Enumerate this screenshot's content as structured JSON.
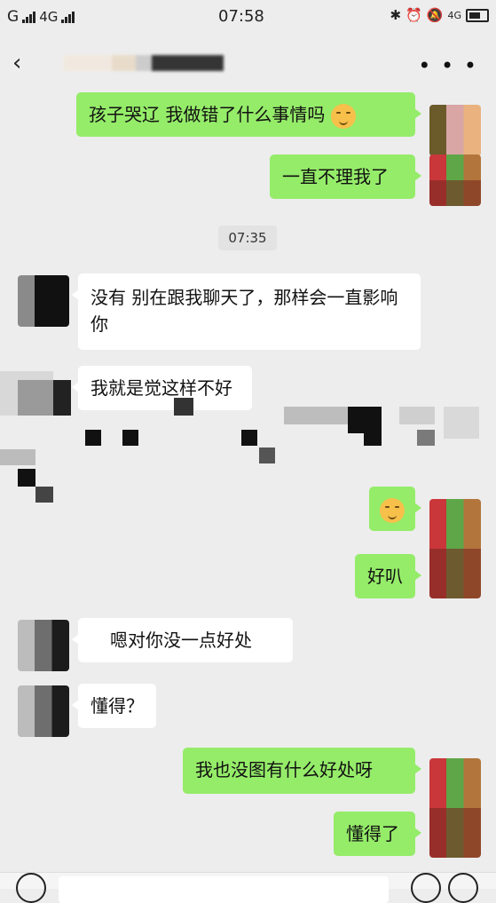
{
  "status_bar": {
    "carrier_g": "G",
    "network": "4G",
    "time": "07:58",
    "right_network": "4G"
  },
  "header": {
    "title": "",
    "back_icon": "chevron-left-icon",
    "more_icon": "more-dots-icon"
  },
  "messages": [
    {
      "side": "me",
      "text": "孩子哭辽 我做错了什么事情吗",
      "emoji": "smiling-face"
    },
    {
      "side": "me",
      "text": "一直不理我了"
    },
    {
      "side": "time",
      "text": "07:35"
    },
    {
      "side": "other",
      "text": "没有   别在跟我聊天了，那样会一直影响你"
    },
    {
      "side": "other",
      "text": "我就是觉这样不好"
    },
    {
      "side": "me",
      "text": "",
      "emoji": "pensive-face"
    },
    {
      "side": "me",
      "text": "好叭"
    },
    {
      "side": "other",
      "text": "嗯对你没一点好处"
    },
    {
      "side": "other",
      "text": "懂得？"
    },
    {
      "side": "me",
      "text": "我也没图有什么好处呀"
    },
    {
      "side": "me",
      "text": "懂得了"
    }
  ],
  "colors": {
    "background": "#ededed",
    "me_bubble": "#95ec69",
    "other_bubble": "#ffffff"
  }
}
